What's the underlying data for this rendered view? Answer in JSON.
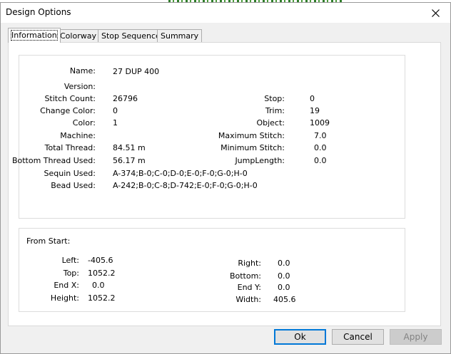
{
  "window": {
    "title": "Design Options"
  },
  "tabs": [
    {
      "label": "Information",
      "active": true
    },
    {
      "label": "Colorway",
      "active": false
    },
    {
      "label": "Stop Sequence",
      "active": false
    },
    {
      "label": "Summary",
      "active": false
    }
  ],
  "info": {
    "left_fields": [
      {
        "label": "Name:",
        "value": "27 DUP 400"
      },
      {
        "label": "Version:",
        "value": ""
      },
      {
        "label": "Stitch Count:",
        "value": "26796"
      },
      {
        "label": "Change Color:",
        "value": "0"
      },
      {
        "label": "Color:",
        "value": "1"
      },
      {
        "label": "Machine:",
        "value": ""
      },
      {
        "label": "Total Thread:",
        "value": "84.51 m"
      },
      {
        "label": "Bottom Thread Used:",
        "value": "56.17 m"
      },
      {
        "label": "Sequin Used:",
        "value": "A-374;B-0;C-0;D-0;E-0;F-0;G-0;H-0"
      },
      {
        "label": "Bead Used:",
        "value": "A-242;B-0;C-8;D-742;E-0;F-0;G-0;H-0"
      }
    ],
    "right_fields": [
      {
        "label": "Stop:",
        "value": "0"
      },
      {
        "label": "Trim:",
        "value": "19"
      },
      {
        "label": "Object:",
        "value": "1009"
      },
      {
        "label": "Maximum Stitch:",
        "value": "7.0"
      },
      {
        "label": "Minimum Stitch:",
        "value": "0.0"
      },
      {
        "label": "JumpLength:",
        "value": "0.0"
      }
    ]
  },
  "from_start": {
    "title": "From Start:",
    "left_fields": [
      {
        "label": "Left:",
        "value": "-405.6"
      },
      {
        "label": "Top:",
        "value": "1052.2"
      },
      {
        "label": "End X:",
        "value": "0.0"
      },
      {
        "label": "Height:",
        "value": "1052.2"
      }
    ],
    "right_fields": [
      {
        "label": "Right:",
        "value": "0.0"
      },
      {
        "label": "Bottom:",
        "value": "0.0"
      },
      {
        "label": "End Y:",
        "value": "0.0"
      },
      {
        "label": "Width:",
        "value": "405.6"
      }
    ]
  },
  "buttons": {
    "ok": "Ok",
    "cancel": "Cancel",
    "apply": "Apply"
  }
}
